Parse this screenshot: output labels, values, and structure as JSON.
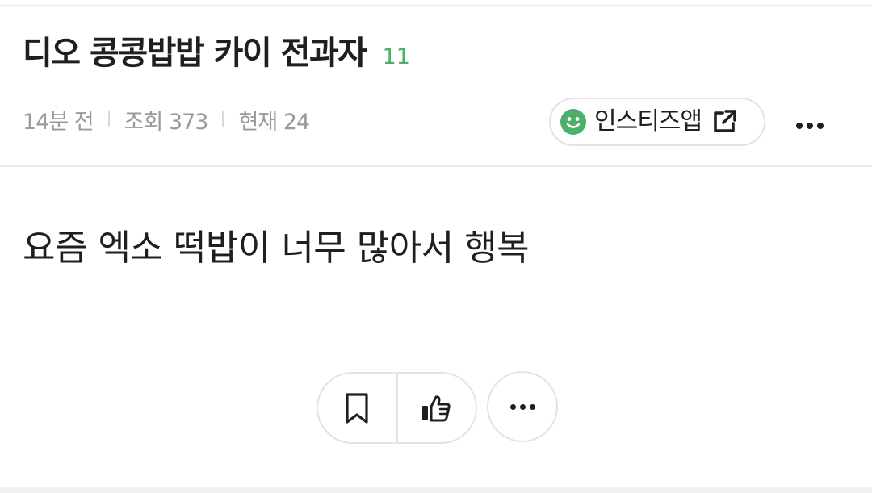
{
  "post": {
    "title": "디오 콩콩밥밥 카이 전과자",
    "comment_count": "11",
    "time_ago": "14분 전",
    "views_label": "조회 373",
    "current_label": "현재 24",
    "body": "요즘 엑소 떡밥이 너무 많아서 행복"
  },
  "app_link": {
    "label": "인스티즈앱",
    "icon": "smile-icon",
    "external_icon": "external-link-icon"
  },
  "actions": {
    "bookmark_icon": "bookmark-icon",
    "like_icon": "thumbs-up-icon",
    "more_icon": "more-icon"
  },
  "colors": {
    "accent_green": "#4caf6a",
    "text": "#1f1f1f",
    "meta_text": "#9a9a9a",
    "border": "#e3e3e3"
  }
}
